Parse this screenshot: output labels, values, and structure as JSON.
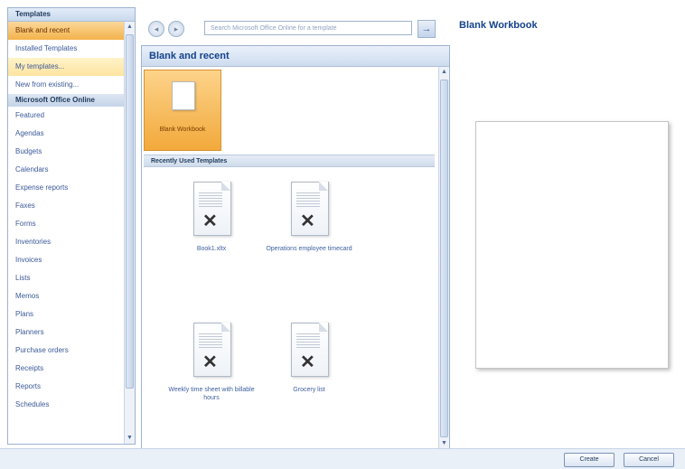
{
  "sidebar": {
    "header": "Templates",
    "items": [
      {
        "label": "Blank and recent",
        "state": "selected"
      },
      {
        "label": "Installed Templates",
        "state": ""
      },
      {
        "label": "My templates...",
        "state": "hover"
      },
      {
        "label": "New from existing...",
        "state": ""
      }
    ],
    "online_section": "Microsoft Office Online",
    "online_items": [
      "Featured",
      "Agendas",
      "Budgets",
      "Calendars",
      "Expense reports",
      "Faxes",
      "Forms",
      "Inventories",
      "Invoices",
      "Lists",
      "Memos",
      "Plans",
      "Planners",
      "Purchase orders",
      "Receipts",
      "Reports",
      "Schedules"
    ]
  },
  "toolbar": {
    "back_icon": "back-arrow-icon",
    "forward_icon": "forward-arrow-icon",
    "search_placeholder": "Search Microsoft Office Online for a template",
    "search_go_icon": "arrow-right-icon"
  },
  "center": {
    "title": "Blank and recent",
    "blank_label": "Blank Workbook",
    "recent_header": "Recently Used Templates",
    "templates": [
      {
        "label": "Book1.xltx"
      },
      {
        "label": "Operations employee timecard"
      },
      {
        "label": "Weekly time sheet with billable hours"
      },
      {
        "label": "Grocery list"
      }
    ]
  },
  "preview": {
    "title": "Blank Workbook"
  },
  "buttons": {
    "create": "Create",
    "cancel": "Cancel"
  }
}
